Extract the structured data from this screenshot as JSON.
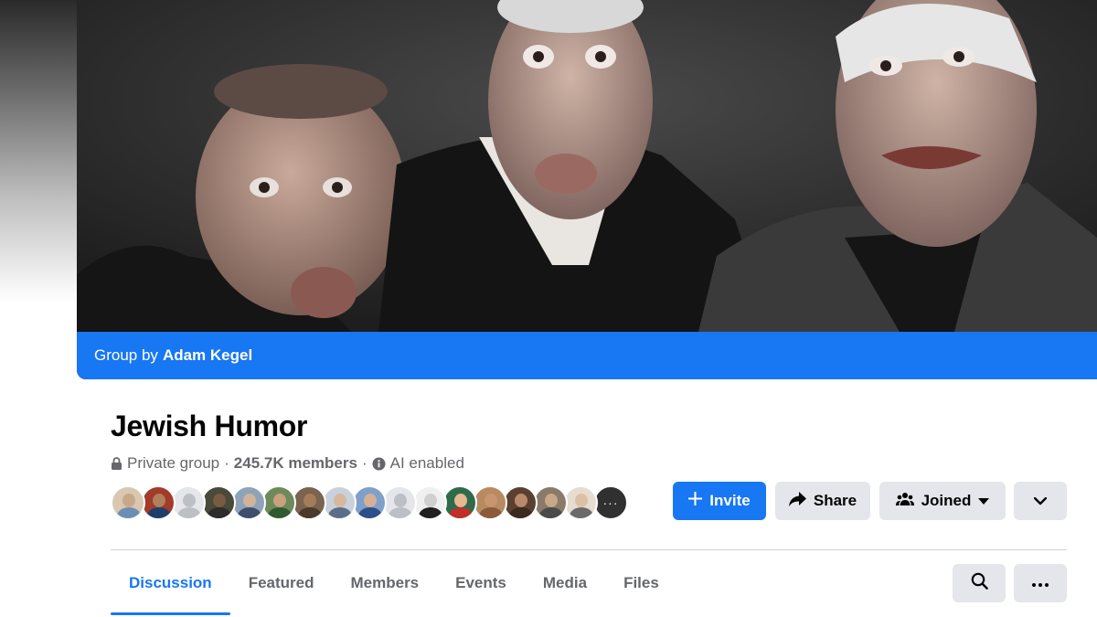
{
  "cover": {
    "group_by_prefix": "Group by",
    "owner_name": "Adam Kegel"
  },
  "group": {
    "name": "Jewish Humor",
    "privacy": "Private group",
    "separator": "·",
    "members": "245.7K members",
    "ai_status": "AI enabled"
  },
  "member_avatars": [
    {
      "face": "#c9a88a",
      "body": "#6b8fb3",
      "bg": "#d9c7b1"
    },
    {
      "face": "#b07f5c",
      "body": "#1f3e6b",
      "bg": "#a33a2a"
    },
    {
      "face": "#bcc0c4",
      "body": "#bcc0c4",
      "bg": "#e4e6eb"
    },
    {
      "face": "#7a5a40",
      "body": "#2c2c2c",
      "bg": "#4a4a3a"
    },
    {
      "face": "#d0b39a",
      "body": "#3d4f6b",
      "bg": "#8fa3b8"
    },
    {
      "face": "#caa080",
      "body": "#2f5a2f",
      "bg": "#6f8a5a"
    },
    {
      "face": "#a57c5a",
      "body": "#4a3a2a",
      "bg": "#7a6450"
    },
    {
      "face": "#d8b89c",
      "body": "#5a6e8a",
      "bg": "#c8d2dc"
    },
    {
      "face": "#d6b094",
      "body": "#2d4f8a",
      "bg": "#7fa0c8"
    },
    {
      "face": "#bcc0c4",
      "body": "#bcc0c4",
      "bg": "#e4e6eb"
    },
    {
      "face": "#d0d0d0",
      "body": "#202020",
      "bg": "#f0f0f0"
    },
    {
      "face": "#e8b890",
      "body": "#c0302a",
      "bg": "#2f6b4a"
    },
    {
      "face": "#c99470",
      "body": "#8a5a3a",
      "bg": "#b88a60"
    },
    {
      "face": "#b88a6a",
      "body": "#3a2a20",
      "bg": "#5a4030"
    },
    {
      "face": "#c8a888",
      "body": "#4a4a4a",
      "bg": "#8a7a6a"
    },
    {
      "face": "#ddc0a4",
      "body": "#6a6a6a",
      "bg": "#e6dcd0"
    }
  ],
  "more_avatars_label": "···",
  "actions": {
    "invite": "Invite",
    "share": "Share",
    "joined": "Joined"
  },
  "tabs": [
    {
      "label": "Discussion",
      "active": true
    },
    {
      "label": "Featured",
      "active": false
    },
    {
      "label": "Members",
      "active": false
    },
    {
      "label": "Events",
      "active": false
    },
    {
      "label": "Media",
      "active": false
    },
    {
      "label": "Files",
      "active": false
    }
  ],
  "colors": {
    "accent": "#1877f2",
    "secondary_button": "#e4e6eb",
    "muted_text": "#65676b"
  },
  "icons": [
    "lock-icon",
    "info-icon",
    "plus-icon",
    "share-arrow-icon",
    "group-people-icon",
    "caret-down-icon",
    "chevron-down-icon",
    "search-icon",
    "more-icon"
  ]
}
